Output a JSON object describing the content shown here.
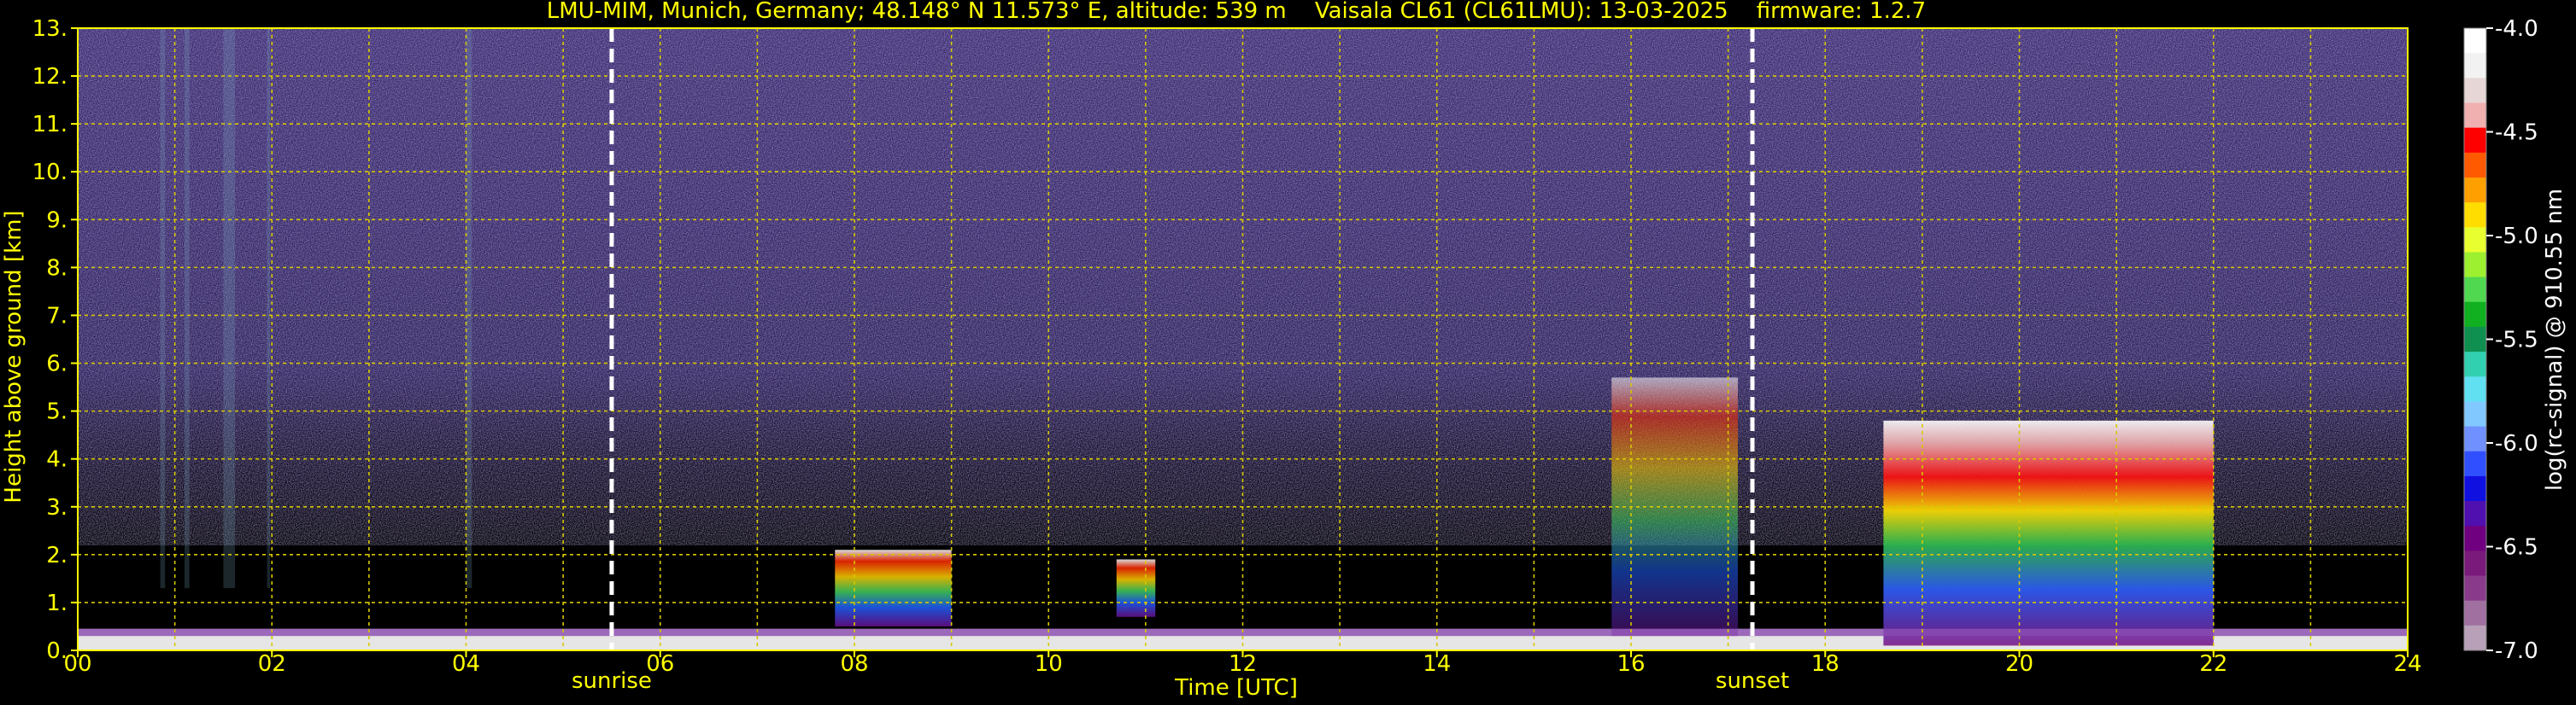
{
  "chart_data": {
    "type": "heatmap",
    "title": "LMU-MIM, Munich, Germany; 48.148° N 11.573° E, altitude: 539 m    Vaisala CL61 (CL61LMU): 13-03-2025    firmware: 1.2.7",
    "xlabel": "Time [UTC]",
    "ylabel": "Height above ground [km]",
    "xlim": [
      0,
      24
    ],
    "ylim": [
      0,
      13
    ],
    "x_ticks": [
      "00",
      "02",
      "04",
      "06",
      "08",
      "10",
      "12",
      "14",
      "16",
      "18",
      "20",
      "22",
      "24"
    ],
    "y_ticks": [
      "0.",
      "1.",
      "2.",
      "3.",
      "4.",
      "5.",
      "6.",
      "7.",
      "8.",
      "9.",
      "10.",
      "11.",
      "12.",
      "13."
    ],
    "grid": true,
    "markers": [
      {
        "label": "sunrise",
        "x": 5.5
      },
      {
        "label": "sunset",
        "x": 17.25
      }
    ],
    "colorbar": {
      "label": "log(rc-signal) @ 910.55 nm",
      "range": [
        -7.0,
        -4.0
      ],
      "ticks": [
        "-4.0",
        "-4.5",
        "-5.0",
        "-5.5",
        "-6.0",
        "-6.5",
        "-7.0"
      ],
      "colors": [
        "#ffffff",
        "#f2f2f2",
        "#e6d6d6",
        "#f0b0b0",
        "#ff0000",
        "#ff5a00",
        "#ffa000",
        "#ffdd00",
        "#e8ff30",
        "#9cf030",
        "#50d850",
        "#10b020",
        "#109050",
        "#30d0b0",
        "#60e0f0",
        "#80c8ff",
        "#7090ff",
        "#3050ff",
        "#1010e0",
        "#5010b0",
        "#700080",
        "#7a1a7a",
        "#8a3a8a",
        "#a070a0",
        "#b8a0b8"
      ]
    },
    "features": [
      {
        "description": "boundary layer aerosol",
        "x": [
          0,
          24
        ],
        "height_km": [
          0,
          0.45
        ]
      },
      {
        "description": "convective clouds",
        "x": [
          7.8,
          9.0
        ],
        "height_km": [
          0.5,
          2.1
        ]
      },
      {
        "description": "cloud",
        "x": [
          10.7,
          11.1
        ],
        "height_km": [
          0.7,
          1.9
        ]
      },
      {
        "description": "cloud layers",
        "x": [
          15.8,
          17.1
        ],
        "height_km": [
          0.3,
          5.7
        ]
      },
      {
        "description": "frontal cloud layer",
        "x": [
          18.6,
          22.0
        ],
        "height_km": [
          0.1,
          4.8
        ]
      }
    ]
  }
}
